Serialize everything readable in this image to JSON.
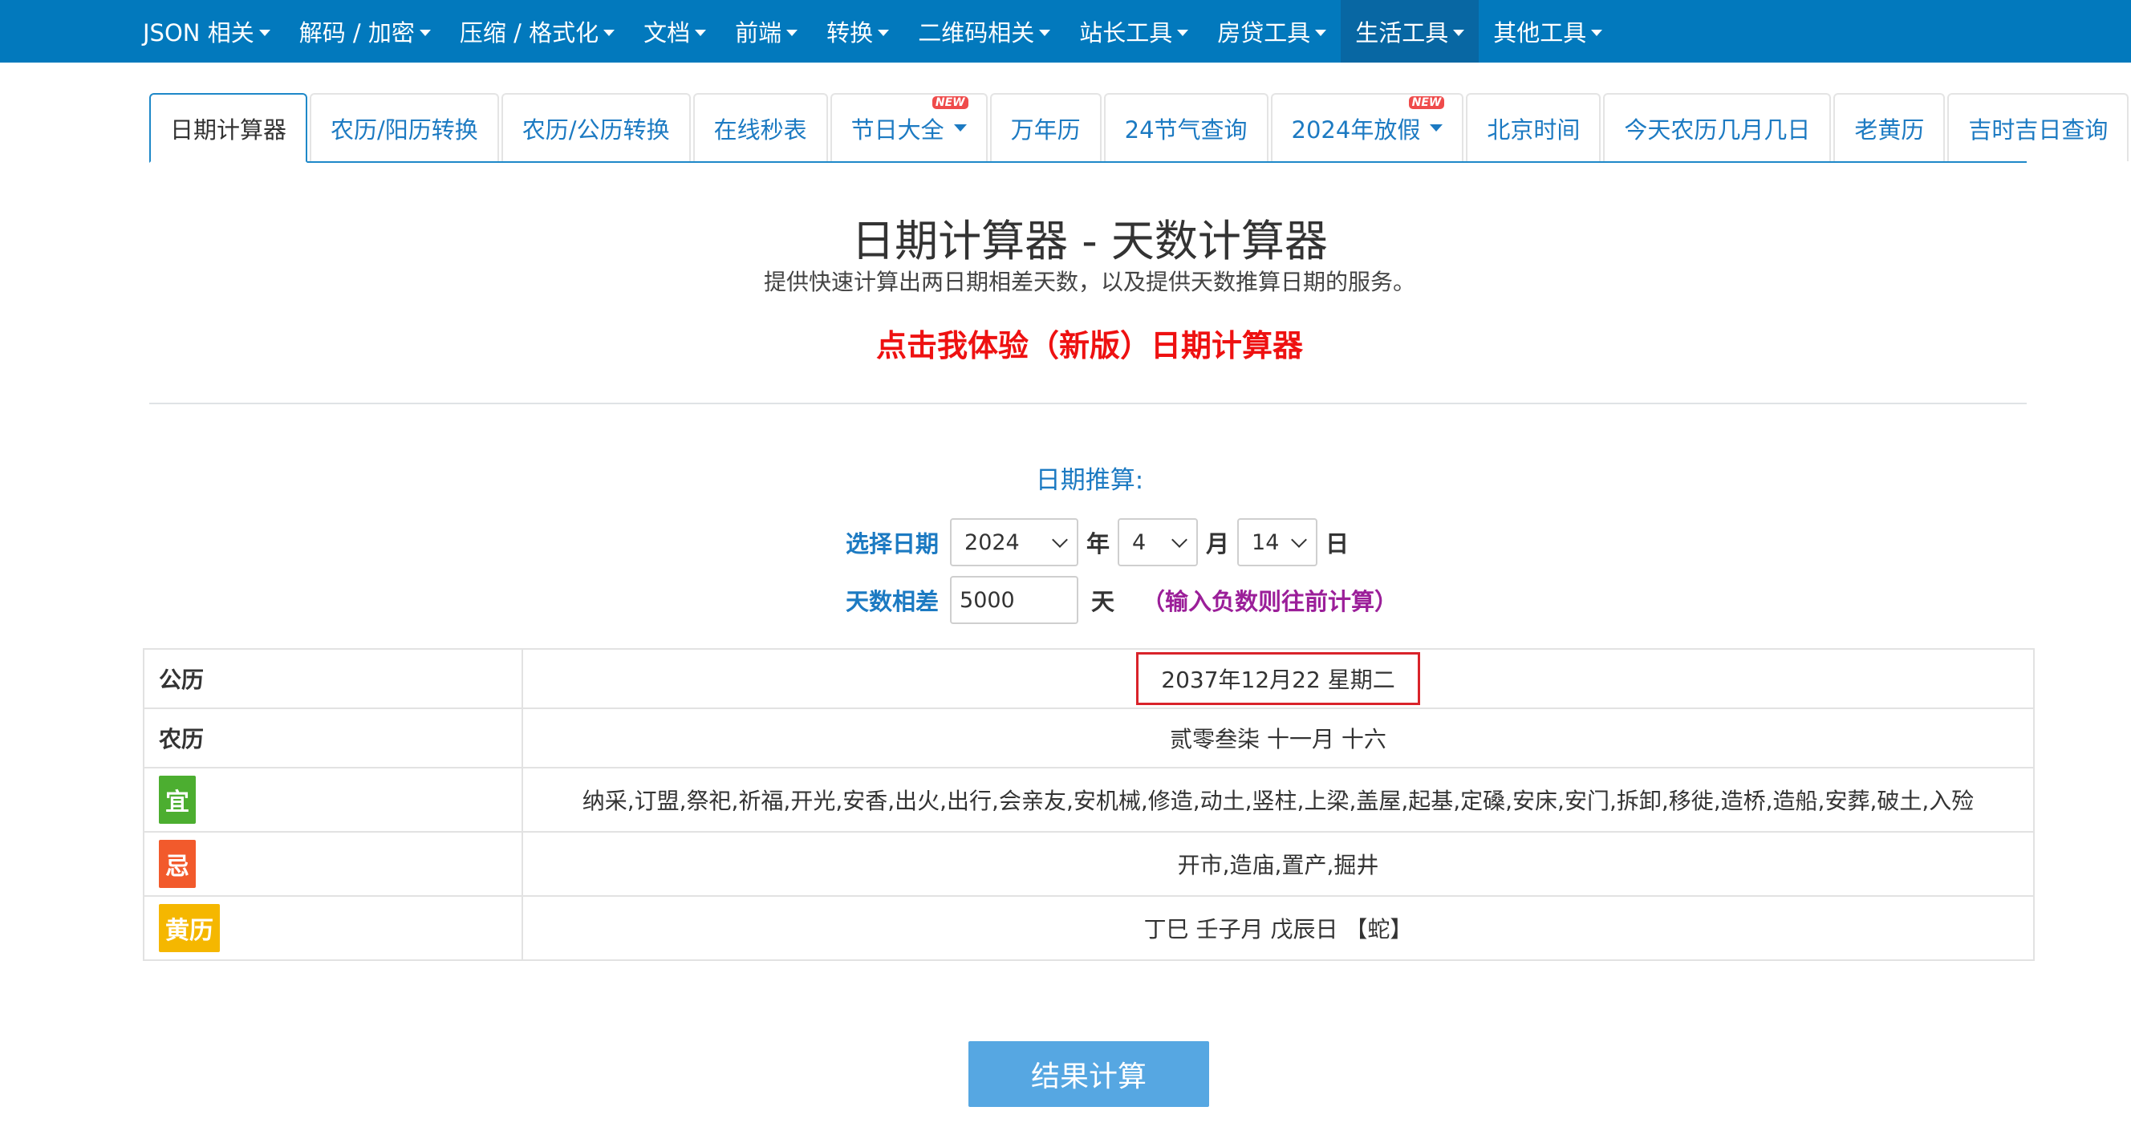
{
  "topnav": {
    "items": [
      {
        "label": "JSON 相关"
      },
      {
        "label": "解码 / 加密"
      },
      {
        "label": "压缩 / 格式化"
      },
      {
        "label": "文档"
      },
      {
        "label": "前端"
      },
      {
        "label": "转换"
      },
      {
        "label": "二维码相关"
      },
      {
        "label": "站长工具"
      },
      {
        "label": "房贷工具"
      },
      {
        "label": "生活工具"
      },
      {
        "label": "其他工具"
      }
    ],
    "active_index": 9,
    "bg_color": "#0279bd"
  },
  "tabs": {
    "items": [
      {
        "label": "日期计算器"
      },
      {
        "label": "农历/阳历转换"
      },
      {
        "label": "农历/公历转换"
      },
      {
        "label": "在线秒表"
      },
      {
        "label": "节日大全",
        "badge": "NEW"
      },
      {
        "label": "万年历"
      },
      {
        "label": "24节气查询"
      },
      {
        "label": "2024年放假",
        "badge": "NEW"
      },
      {
        "label": "北京时间"
      },
      {
        "label": "今天农历几月几日"
      },
      {
        "label": "老黄历"
      },
      {
        "label": "吉时吉日查询"
      }
    ],
    "active_index": 0
  },
  "header": {
    "title": "日期计算器 - 天数计算器",
    "subtitle": "提供快速计算出两日期相差天数，以及提供天数推算日期的服务。",
    "promo_link": "点击我体验（新版）日期计算器"
  },
  "form": {
    "heading": "日期推算:",
    "date_label": "选择日期",
    "year_value": "2024",
    "year_unit": "年",
    "month_value": "4",
    "month_unit": "月",
    "day_value": "14",
    "day_unit": "日",
    "days_label": "天数相差",
    "days_value": "5000",
    "days_unit": "天",
    "hint": "（输入负数则往前计算）"
  },
  "results": {
    "gregorian_label": "公历",
    "gregorian_value": "2037年12月22 星期二",
    "lunar_label": "农历",
    "lunar_value": "贰零叁柒 十一月 十六",
    "yi_label": "宜",
    "yi_value": "纳采,订盟,祭祀,祈福,开光,安香,出火,出行,会亲友,安机械,修造,动土,竖柱,上梁,盖屋,起基,定磉,安床,安门,拆卸,移徙,造桥,造船,安葬,破土,入殓",
    "ji_label": "忌",
    "ji_value": "开市,造庙,置产,掘井",
    "huangli_label": "黄历",
    "huangli_value": "丁巳 壬子月 戊辰日 【蛇】"
  },
  "submit_label": "结果计算",
  "colors": {
    "accent": "#1c7ac2",
    "promo": "#ee1111",
    "hint": "#9b1f99",
    "yi": "#4cae30",
    "ji": "#f25a2c",
    "huangli": "#f5b700",
    "button": "#56a7e2"
  }
}
